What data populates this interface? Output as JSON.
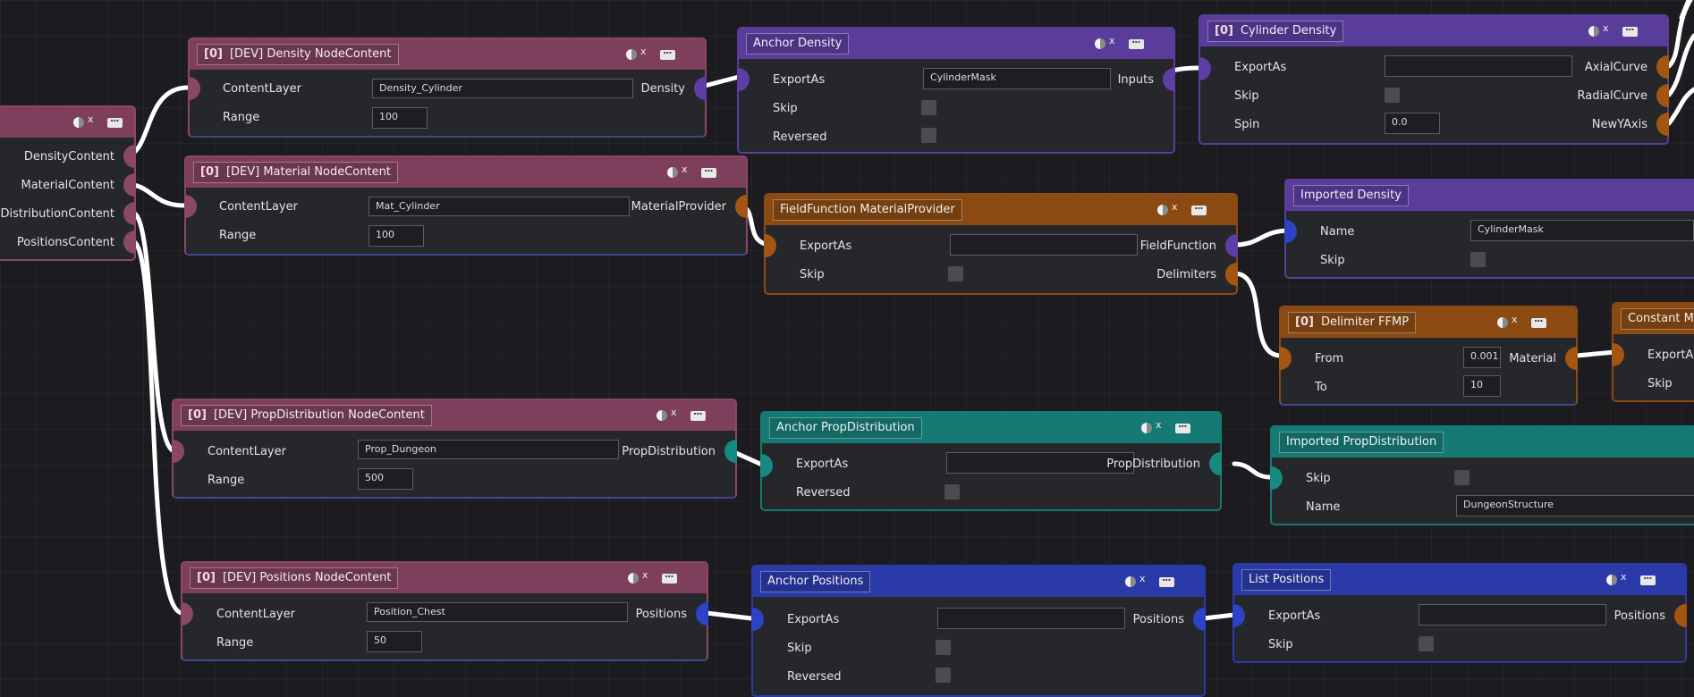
{
  "colors": {
    "pink": "#7d3f5c",
    "pink_border": "#8b4766",
    "purple": "#5a3c9b",
    "orange": "#8a4a12",
    "teal": "#157a73",
    "blue": "#2a3aa8",
    "background": "#1c1c20",
    "port_pink": "#8b4766",
    "port_purple": "#5e3ea6",
    "port_orange": "#a35512",
    "port_teal": "#168a80",
    "port_blue": "#2d42c4"
  },
  "icons": {
    "enable_toggle": "half-circle-toggle-icon",
    "menu": "ellipsis-menu-icon"
  },
  "nodes": {
    "root": {
      "outputs": [
        "DensityContent",
        "MaterialContent",
        "ropDistributionContent",
        "PositionsContent"
      ]
    },
    "density_content": {
      "tag": "[0]",
      "title": "[DEV] Density NodeContent",
      "content_layer_label": "ContentLayer",
      "content_layer_value": "Density_Cylinder",
      "range_label": "Range",
      "range_value": "100",
      "output": "Density"
    },
    "material_content": {
      "tag": "[0]",
      "title": "[DEV] Material NodeContent",
      "content_layer_label": "ContentLayer",
      "content_layer_value": "Mat_Cylinder",
      "range_label": "Range",
      "range_value": "100",
      "output": "MaterialProvider"
    },
    "propdist_content": {
      "tag": "[0]",
      "title": "[DEV] PropDistribution NodeContent",
      "content_layer_label": "ContentLayer",
      "content_layer_value": "Prop_Dungeon",
      "range_label": "Range",
      "range_value": "500",
      "output": "PropDistribution"
    },
    "positions_content": {
      "tag": "[0]",
      "title": "[DEV] Positions NodeContent",
      "content_layer_label": "ContentLayer",
      "content_layer_value": "Position_Chest",
      "range_label": "Range",
      "range_value": "50",
      "output": "Positions"
    },
    "anchor_density": {
      "title": "Anchor Density",
      "export_label": "ExportAs",
      "export_value": "CylinderMask",
      "skip_label": "Skip",
      "reversed_label": "Reversed",
      "output": "Inputs"
    },
    "cylinder_density": {
      "tag": "[0]",
      "title": "Cylinder Density",
      "export_label": "ExportAs",
      "export_value": "",
      "skip_label": "Skip",
      "spin_label": "Spin",
      "spin_value": "0.0",
      "outputs": [
        "AxialCurve",
        "RadialCurve",
        "NewYAxis"
      ]
    },
    "fieldfunction": {
      "title": "FieldFunction MaterialProvider",
      "export_label": "ExportAs",
      "export_value": "",
      "skip_label": "Skip",
      "outputs": [
        "FieldFunction",
        "Delimiters"
      ]
    },
    "imported_density": {
      "title": "Imported Density",
      "name_label": "Name",
      "name_value": "CylinderMask",
      "skip_label": "Skip"
    },
    "delimiter_ffmp": {
      "tag": "[0]",
      "title": "Delimiter FFMP",
      "from_label": "From",
      "from_value": "0.001",
      "to_label": "To",
      "to_value": "10",
      "output": "Material"
    },
    "constant_material": {
      "title": "Constant Mate",
      "export_label": "ExportAs",
      "skip_label": "Skip"
    },
    "anchor_propdist": {
      "title": "Anchor PropDistribution",
      "export_label": "ExportAs",
      "export_value": "",
      "reversed_label": "Reversed",
      "output": "PropDistribution"
    },
    "imported_propdist": {
      "title": "Imported PropDistribution",
      "skip_label": "Skip",
      "name_label": "Name",
      "name_value": "DungeonStructure"
    },
    "anchor_positions": {
      "title": "Anchor Positions",
      "export_label": "ExportAs",
      "export_value": "",
      "skip_label": "Skip",
      "reversed_label": "Reversed",
      "output": "Positions"
    },
    "list_positions": {
      "title": "List Positions",
      "export_label": "ExportAs",
      "export_value": "",
      "skip_label": "Skip",
      "output": "Positions"
    }
  }
}
